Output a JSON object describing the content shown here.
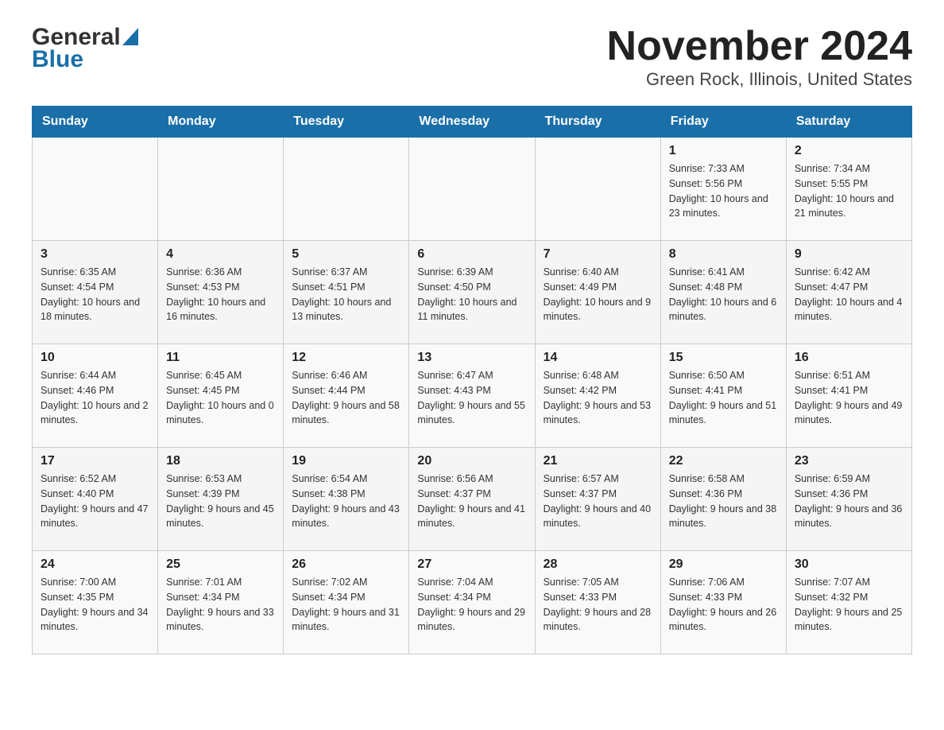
{
  "logo": {
    "general": "General",
    "blue": "Blue"
  },
  "title": "November 2024",
  "subtitle": "Green Rock, Illinois, United States",
  "days_of_week": [
    "Sunday",
    "Monday",
    "Tuesday",
    "Wednesday",
    "Thursday",
    "Friday",
    "Saturday"
  ],
  "weeks": [
    [
      {
        "day": "",
        "info": ""
      },
      {
        "day": "",
        "info": ""
      },
      {
        "day": "",
        "info": ""
      },
      {
        "day": "",
        "info": ""
      },
      {
        "day": "",
        "info": ""
      },
      {
        "day": "1",
        "info": "Sunrise: 7:33 AM\nSunset: 5:56 PM\nDaylight: 10 hours and 23 minutes."
      },
      {
        "day": "2",
        "info": "Sunrise: 7:34 AM\nSunset: 5:55 PM\nDaylight: 10 hours and 21 minutes."
      }
    ],
    [
      {
        "day": "3",
        "info": "Sunrise: 6:35 AM\nSunset: 4:54 PM\nDaylight: 10 hours and 18 minutes."
      },
      {
        "day": "4",
        "info": "Sunrise: 6:36 AM\nSunset: 4:53 PM\nDaylight: 10 hours and 16 minutes."
      },
      {
        "day": "5",
        "info": "Sunrise: 6:37 AM\nSunset: 4:51 PM\nDaylight: 10 hours and 13 minutes."
      },
      {
        "day": "6",
        "info": "Sunrise: 6:39 AM\nSunset: 4:50 PM\nDaylight: 10 hours and 11 minutes."
      },
      {
        "day": "7",
        "info": "Sunrise: 6:40 AM\nSunset: 4:49 PM\nDaylight: 10 hours and 9 minutes."
      },
      {
        "day": "8",
        "info": "Sunrise: 6:41 AM\nSunset: 4:48 PM\nDaylight: 10 hours and 6 minutes."
      },
      {
        "day": "9",
        "info": "Sunrise: 6:42 AM\nSunset: 4:47 PM\nDaylight: 10 hours and 4 minutes."
      }
    ],
    [
      {
        "day": "10",
        "info": "Sunrise: 6:44 AM\nSunset: 4:46 PM\nDaylight: 10 hours and 2 minutes."
      },
      {
        "day": "11",
        "info": "Sunrise: 6:45 AM\nSunset: 4:45 PM\nDaylight: 10 hours and 0 minutes."
      },
      {
        "day": "12",
        "info": "Sunrise: 6:46 AM\nSunset: 4:44 PM\nDaylight: 9 hours and 58 minutes."
      },
      {
        "day": "13",
        "info": "Sunrise: 6:47 AM\nSunset: 4:43 PM\nDaylight: 9 hours and 55 minutes."
      },
      {
        "day": "14",
        "info": "Sunrise: 6:48 AM\nSunset: 4:42 PM\nDaylight: 9 hours and 53 minutes."
      },
      {
        "day": "15",
        "info": "Sunrise: 6:50 AM\nSunset: 4:41 PM\nDaylight: 9 hours and 51 minutes."
      },
      {
        "day": "16",
        "info": "Sunrise: 6:51 AM\nSunset: 4:41 PM\nDaylight: 9 hours and 49 minutes."
      }
    ],
    [
      {
        "day": "17",
        "info": "Sunrise: 6:52 AM\nSunset: 4:40 PM\nDaylight: 9 hours and 47 minutes."
      },
      {
        "day": "18",
        "info": "Sunrise: 6:53 AM\nSunset: 4:39 PM\nDaylight: 9 hours and 45 minutes."
      },
      {
        "day": "19",
        "info": "Sunrise: 6:54 AM\nSunset: 4:38 PM\nDaylight: 9 hours and 43 minutes."
      },
      {
        "day": "20",
        "info": "Sunrise: 6:56 AM\nSunset: 4:37 PM\nDaylight: 9 hours and 41 minutes."
      },
      {
        "day": "21",
        "info": "Sunrise: 6:57 AM\nSunset: 4:37 PM\nDaylight: 9 hours and 40 minutes."
      },
      {
        "day": "22",
        "info": "Sunrise: 6:58 AM\nSunset: 4:36 PM\nDaylight: 9 hours and 38 minutes."
      },
      {
        "day": "23",
        "info": "Sunrise: 6:59 AM\nSunset: 4:36 PM\nDaylight: 9 hours and 36 minutes."
      }
    ],
    [
      {
        "day": "24",
        "info": "Sunrise: 7:00 AM\nSunset: 4:35 PM\nDaylight: 9 hours and 34 minutes."
      },
      {
        "day": "25",
        "info": "Sunrise: 7:01 AM\nSunset: 4:34 PM\nDaylight: 9 hours and 33 minutes."
      },
      {
        "day": "26",
        "info": "Sunrise: 7:02 AM\nSunset: 4:34 PM\nDaylight: 9 hours and 31 minutes."
      },
      {
        "day": "27",
        "info": "Sunrise: 7:04 AM\nSunset: 4:34 PM\nDaylight: 9 hours and 29 minutes."
      },
      {
        "day": "28",
        "info": "Sunrise: 7:05 AM\nSunset: 4:33 PM\nDaylight: 9 hours and 28 minutes."
      },
      {
        "day": "29",
        "info": "Sunrise: 7:06 AM\nSunset: 4:33 PM\nDaylight: 9 hours and 26 minutes."
      },
      {
        "day": "30",
        "info": "Sunrise: 7:07 AM\nSunset: 4:32 PM\nDaylight: 9 hours and 25 minutes."
      }
    ]
  ]
}
